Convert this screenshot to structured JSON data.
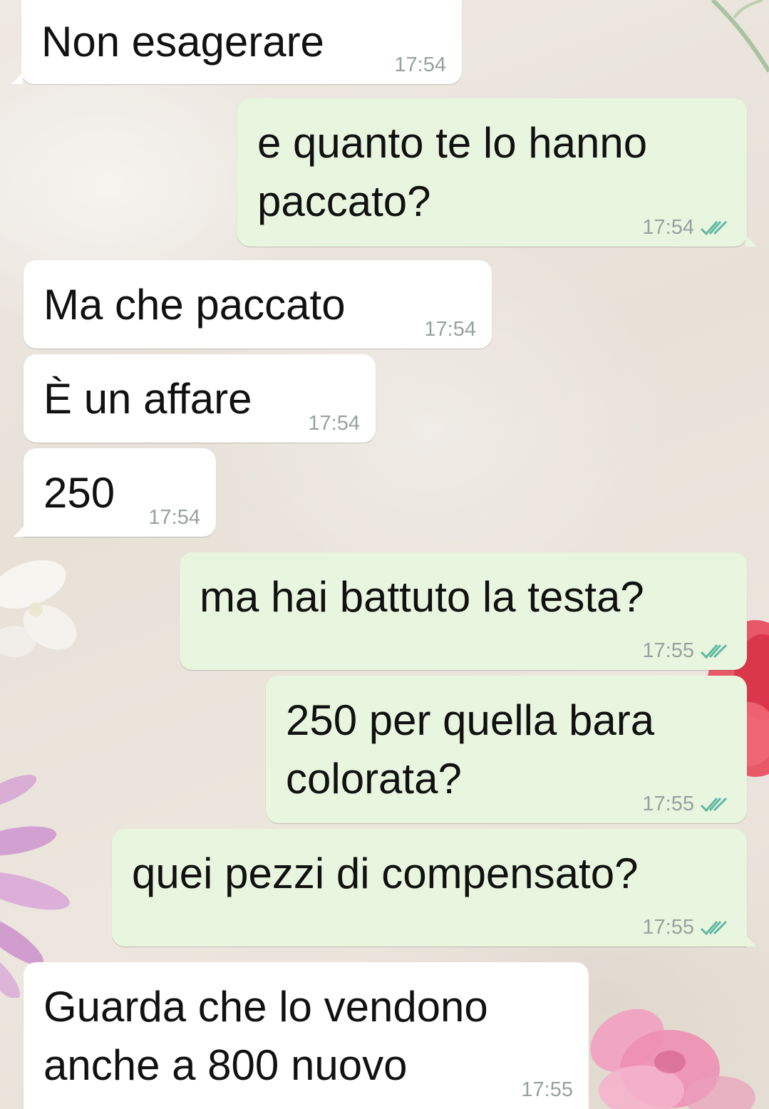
{
  "colors": {
    "incoming_bubble": "#ffffff",
    "outgoing_bubble": "#e8f6df",
    "timestamp": "#97a19f",
    "read_ticks": "#5fb8a3",
    "message_text": "#111111"
  },
  "messages": [
    {
      "direction": "incoming",
      "lines": [
        "Non esagerare"
      ],
      "time": "17:54"
    },
    {
      "direction": "outgoing",
      "lines": [
        "e quanto te lo hanno",
        "paccato?"
      ],
      "time": "17:54",
      "status_icon": "double-check-icon"
    },
    {
      "direction": "incoming",
      "lines": [
        "Ma che paccato"
      ],
      "time": "17:54"
    },
    {
      "direction": "incoming",
      "lines": [
        "È un affare"
      ],
      "time": "17:54"
    },
    {
      "direction": "incoming",
      "lines": [
        "250"
      ],
      "time": "17:54"
    },
    {
      "direction": "outgoing",
      "lines": [
        "ma hai battuto la testa?"
      ],
      "time": "17:55",
      "status_icon": "double-check-icon"
    },
    {
      "direction": "outgoing",
      "lines": [
        "250 per quella bara",
        "colorata?"
      ],
      "time": "17:55",
      "status_icon": "double-check-icon"
    },
    {
      "direction": "outgoing",
      "lines": [
        "quei pezzi di compensato?"
      ],
      "time": "17:55",
      "status_icon": "double-check-icon"
    },
    {
      "direction": "incoming",
      "lines": [
        "Guarda che lo vendono",
        "anche a 800 nuovo"
      ],
      "time": "17:55"
    }
  ]
}
